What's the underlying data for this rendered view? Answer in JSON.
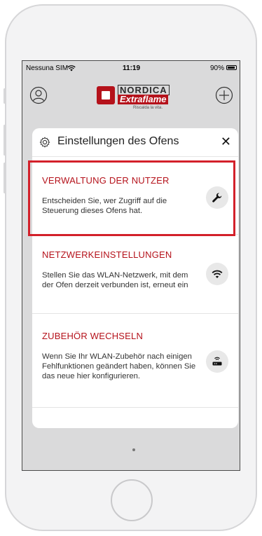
{
  "status_bar": {
    "carrier": "Nessuna SIM",
    "time": "11:19",
    "battery": "90%"
  },
  "header": {
    "logo_top": "NORDICA",
    "logo_main": "Extraflame",
    "logo_tagline": "Riscalda la vita."
  },
  "settings": {
    "title": "Einstellungen des Ofens",
    "close_label": "✕",
    "items": [
      {
        "title": "VERWALTUNG DER NUTZER",
        "description": "Entscheiden Sie, wer Zugriff auf die Steuerung dieses Ofens hat.",
        "icon": "wrench-icon"
      },
      {
        "title": "NETZWERKEINSTELLUNGEN",
        "description": "Stellen Sie das WLAN-Netzwerk, mit dem der Ofen derzeit verbunden ist, erneut ein",
        "icon": "wifi-icon"
      },
      {
        "title": "ZUBEHÖR WECHSELN",
        "description": "Wenn Sie Ihr WLAN-Zubehör nach einigen Fehlfunktionen geändert haben, können Sie das neue hier konfigurieren.",
        "icon": "router-icon"
      }
    ]
  },
  "colors": {
    "accent": "#b5121b",
    "highlight": "#d3202a"
  }
}
